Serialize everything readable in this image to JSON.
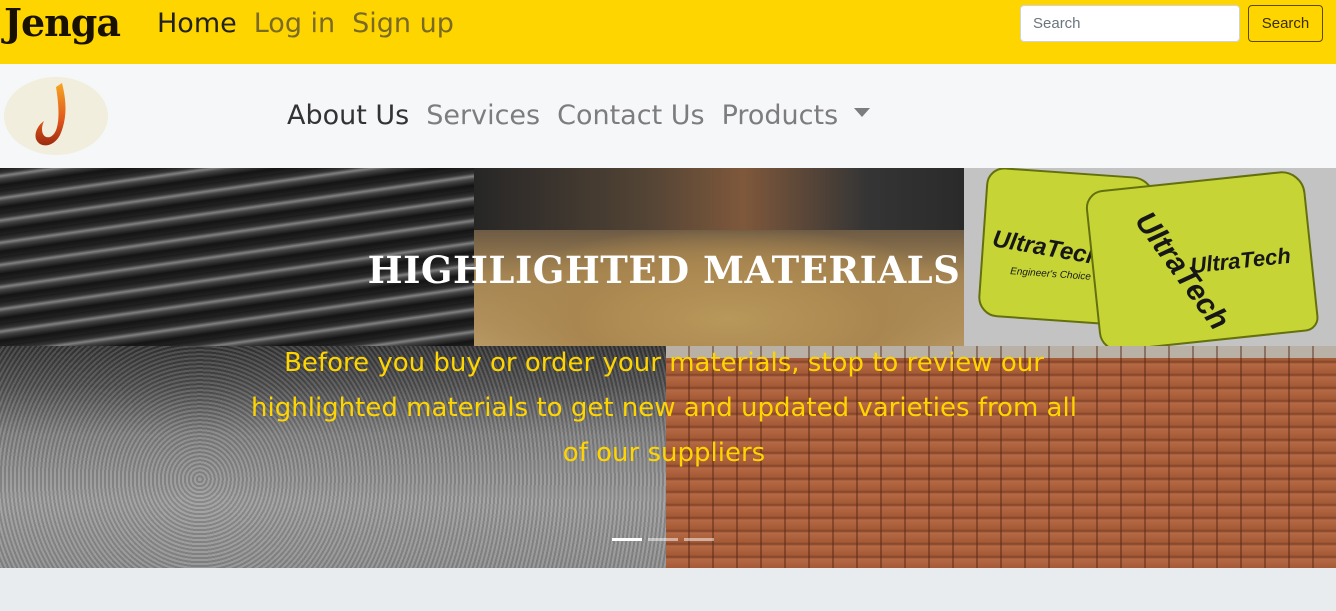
{
  "topbar": {
    "brand": "Jenga",
    "nav": [
      {
        "label": "Home",
        "active": true
      },
      {
        "label": "Log in",
        "active": false
      },
      {
        "label": "Sign up",
        "active": false
      }
    ],
    "search_placeholder": "Search",
    "search_button": "Search",
    "background": "#ffd500"
  },
  "subnav": {
    "items": [
      {
        "label": "About Us",
        "active": true
      },
      {
        "label": "Services",
        "active": false
      },
      {
        "label": "Contact Us",
        "active": false
      },
      {
        "label": "Products",
        "active": false,
        "dropdown": true
      }
    ]
  },
  "carousel": {
    "title": "HIGHLIGHTED MATERIALS",
    "text": "Before you buy or order your materials, stop to review our highlighted materials to get new and updated varieties from all of our suppliers",
    "images": [
      "rebar",
      "sand",
      "cement-bags",
      "gravel",
      "bricks"
    ],
    "bag_brand": "UltraTech",
    "bag_tagline": "Engineer's Choice",
    "indicators": 3,
    "active_indicator": 0,
    "text_color": "#ffd500"
  }
}
